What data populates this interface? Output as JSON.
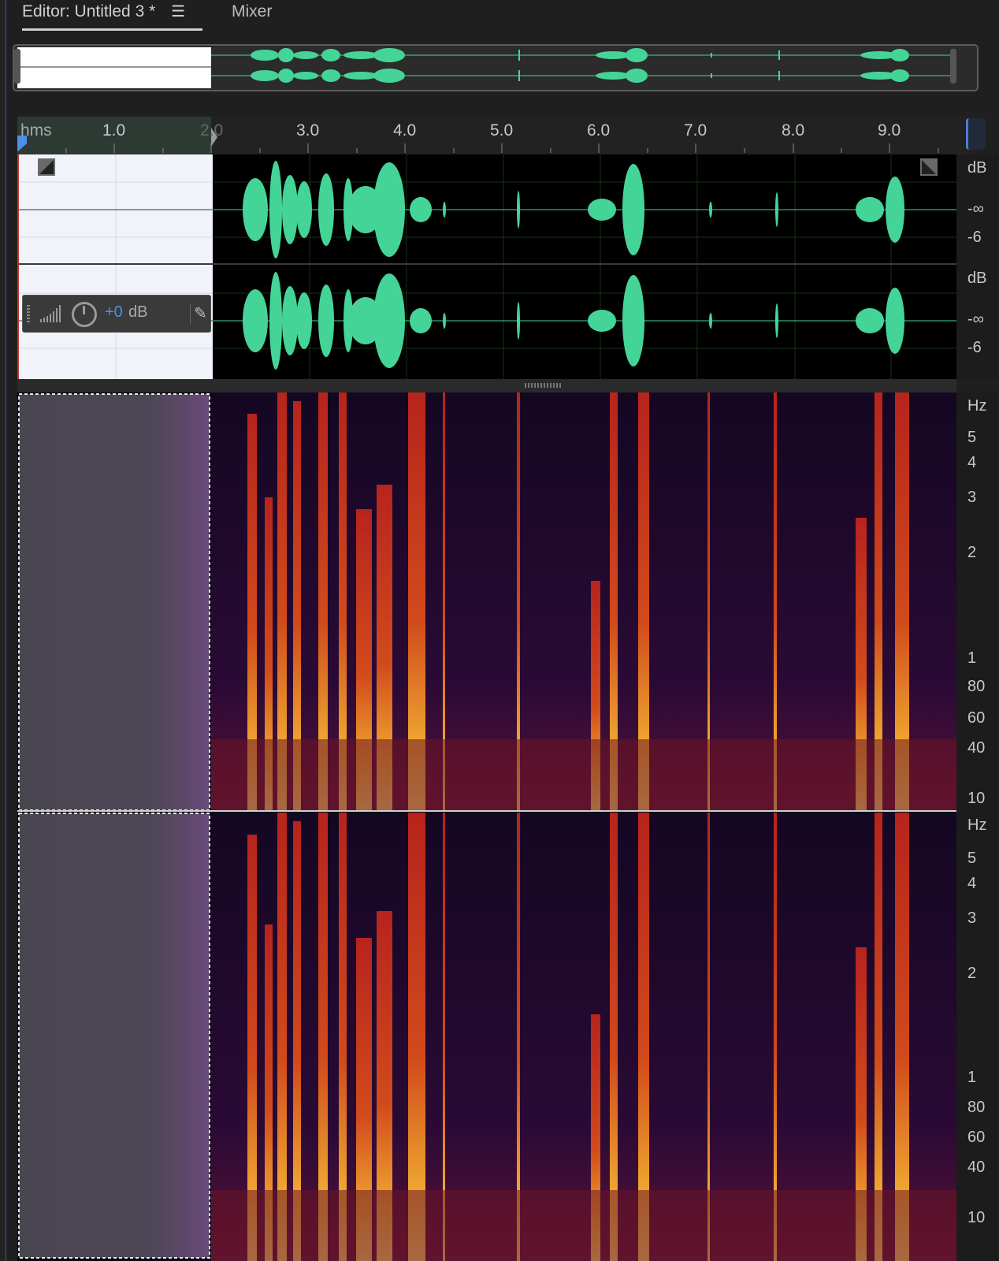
{
  "tabs": {
    "editor_label": "Editor: Untitled 3 *",
    "menu_icon": "☰",
    "mixer_label": "Mixer"
  },
  "ruler": {
    "unit_label": "hms",
    "ticks": [
      "1.0",
      "2.0",
      "3.0",
      "4.0",
      "5.0",
      "6.0",
      "7.0",
      "8.0",
      "9.0"
    ]
  },
  "track": {
    "gain_value": "+0",
    "gain_unit": "dB",
    "pin_icon": "pin-icon"
  },
  "waveform_scale": {
    "ch1_labels": [
      "dB",
      "-∞",
      "-6"
    ],
    "ch2_labels": [
      "dB",
      "-∞",
      "-6"
    ]
  },
  "spectral_scale": {
    "ch1_labels": [
      "Hz",
      "5",
      "4",
      "3",
      "2",
      "1",
      "80",
      "60",
      "40",
      "10"
    ],
    "ch2_labels": [
      "Hz",
      "5",
      "4",
      "3",
      "2",
      "1",
      "80",
      "60",
      "40",
      "10"
    ]
  },
  "colors": {
    "waveform": "#45d498",
    "spectral_low": "#2a0a35",
    "spectral_mid": "#c4261c",
    "spectral_high": "#ffcf3a",
    "accent_blue": "#4e8fe6"
  }
}
